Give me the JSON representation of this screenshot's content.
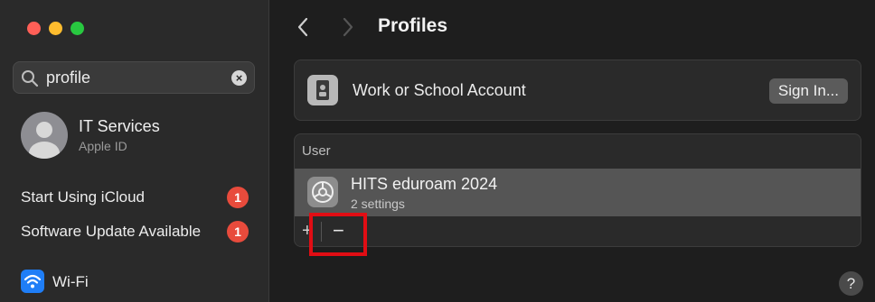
{
  "sidebar": {
    "search": {
      "value": "profile",
      "placeholder": "Search"
    },
    "account": {
      "name": "IT Services",
      "subtitle": "Apple ID"
    },
    "items": [
      {
        "label": "Start Using iCloud",
        "badge": "1"
      },
      {
        "label": "Software Update Available",
        "badge": "1"
      }
    ],
    "wifi_label": "Wi-Fi"
  },
  "header": {
    "title": "Profiles"
  },
  "work_account": {
    "label": "Work or School Account",
    "button": "Sign In..."
  },
  "profiles": {
    "section_header": "User",
    "items": [
      {
        "name": "HITS eduroam 2024",
        "subtitle": "2 settings"
      }
    ],
    "add_label": "+",
    "remove_label": "−"
  },
  "help_label": "?",
  "colors": {
    "badge": "#e84b3c",
    "highlight": "#e10d14",
    "wifi": "#1f7ef7"
  },
  "icons": [
    "search-icon",
    "clear-icon",
    "avatar-icon",
    "wifi-icon",
    "chevron-left-icon",
    "chevron-right-icon",
    "id-badge-icon",
    "gear-icon"
  ]
}
